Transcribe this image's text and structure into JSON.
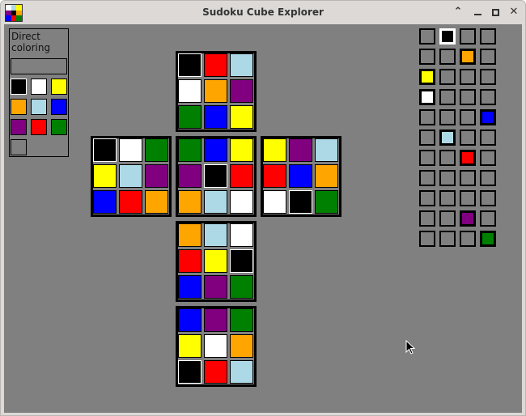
{
  "window": {
    "title": "Sudoku Cube Explorer",
    "controls": [
      "chevron-up-icon",
      "minimize-icon",
      "maximize-icon",
      "close-icon"
    ]
  },
  "app_icon_colors": [
    "#ffffff",
    "#add8e6",
    "#ffff00",
    "#800080",
    "#000000",
    "#ffa500",
    "#0000ff",
    "#ff0000",
    "#008000"
  ],
  "panel": {
    "title": "Direct coloring",
    "input_value": "",
    "swatches": [
      "#000000",
      "#ffffff",
      "#ffff00",
      "#ffa500",
      "#add8e6",
      "#0000ff",
      "#800080",
      "#ff0000",
      "#008000",
      "#808080"
    ],
    "selected_swatch": 0
  },
  "cube": {
    "top": [
      "#000000",
      "#ff0000",
      "#add8e6",
      "#ffffff",
      "#ffa500",
      "#800080",
      "#008000",
      "#0000ff",
      "#ffff00"
    ],
    "left": [
      "#000000",
      "#ffffff",
      "#008000",
      "#ffff00",
      "#add8e6",
      "#800080",
      "#0000ff",
      "#ff0000",
      "#ffa500"
    ],
    "front": [
      "#008000",
      "#0000ff",
      "#ffff00",
      "#800080",
      "#000000",
      "#ff0000",
      "#ffa500",
      "#add8e6",
      "#ffffff"
    ],
    "right": [
      "#ffff00",
      "#800080",
      "#add8e6",
      "#ff0000",
      "#0000ff",
      "#ffa500",
      "#ffffff",
      "#000000",
      "#008000"
    ],
    "bottom": [
      "#ffa500",
      "#add8e6",
      "#ffffff",
      "#ff0000",
      "#ffff00",
      "#000000",
      "#0000ff",
      "#800080",
      "#008000"
    ],
    "back": [
      "#0000ff",
      "#800080",
      "#008000",
      "#ffff00",
      "#ffffff",
      "#ffa500",
      "#000000",
      "#ff0000",
      "#add8e6"
    ]
  },
  "assignment_grid": {
    "columns": 4,
    "rows": [
      {
        "col": 1,
        "color": "#000000"
      },
      {
        "col": 2,
        "color": "#ffa500"
      },
      {
        "col": 0,
        "color": "#ffff00"
      },
      {
        "col": 0,
        "color": "#ffffff"
      },
      {
        "col": 3,
        "color": "#0000ff"
      },
      {
        "col": 1,
        "color": "#add8e6"
      },
      {
        "col": 2,
        "color": "#ff0000"
      },
      {
        "col": null,
        "color": null
      },
      {
        "col": null,
        "color": null
      },
      {
        "col": 2,
        "color": "#800080"
      },
      {
        "col": 3,
        "color": "#008000"
      }
    ]
  }
}
